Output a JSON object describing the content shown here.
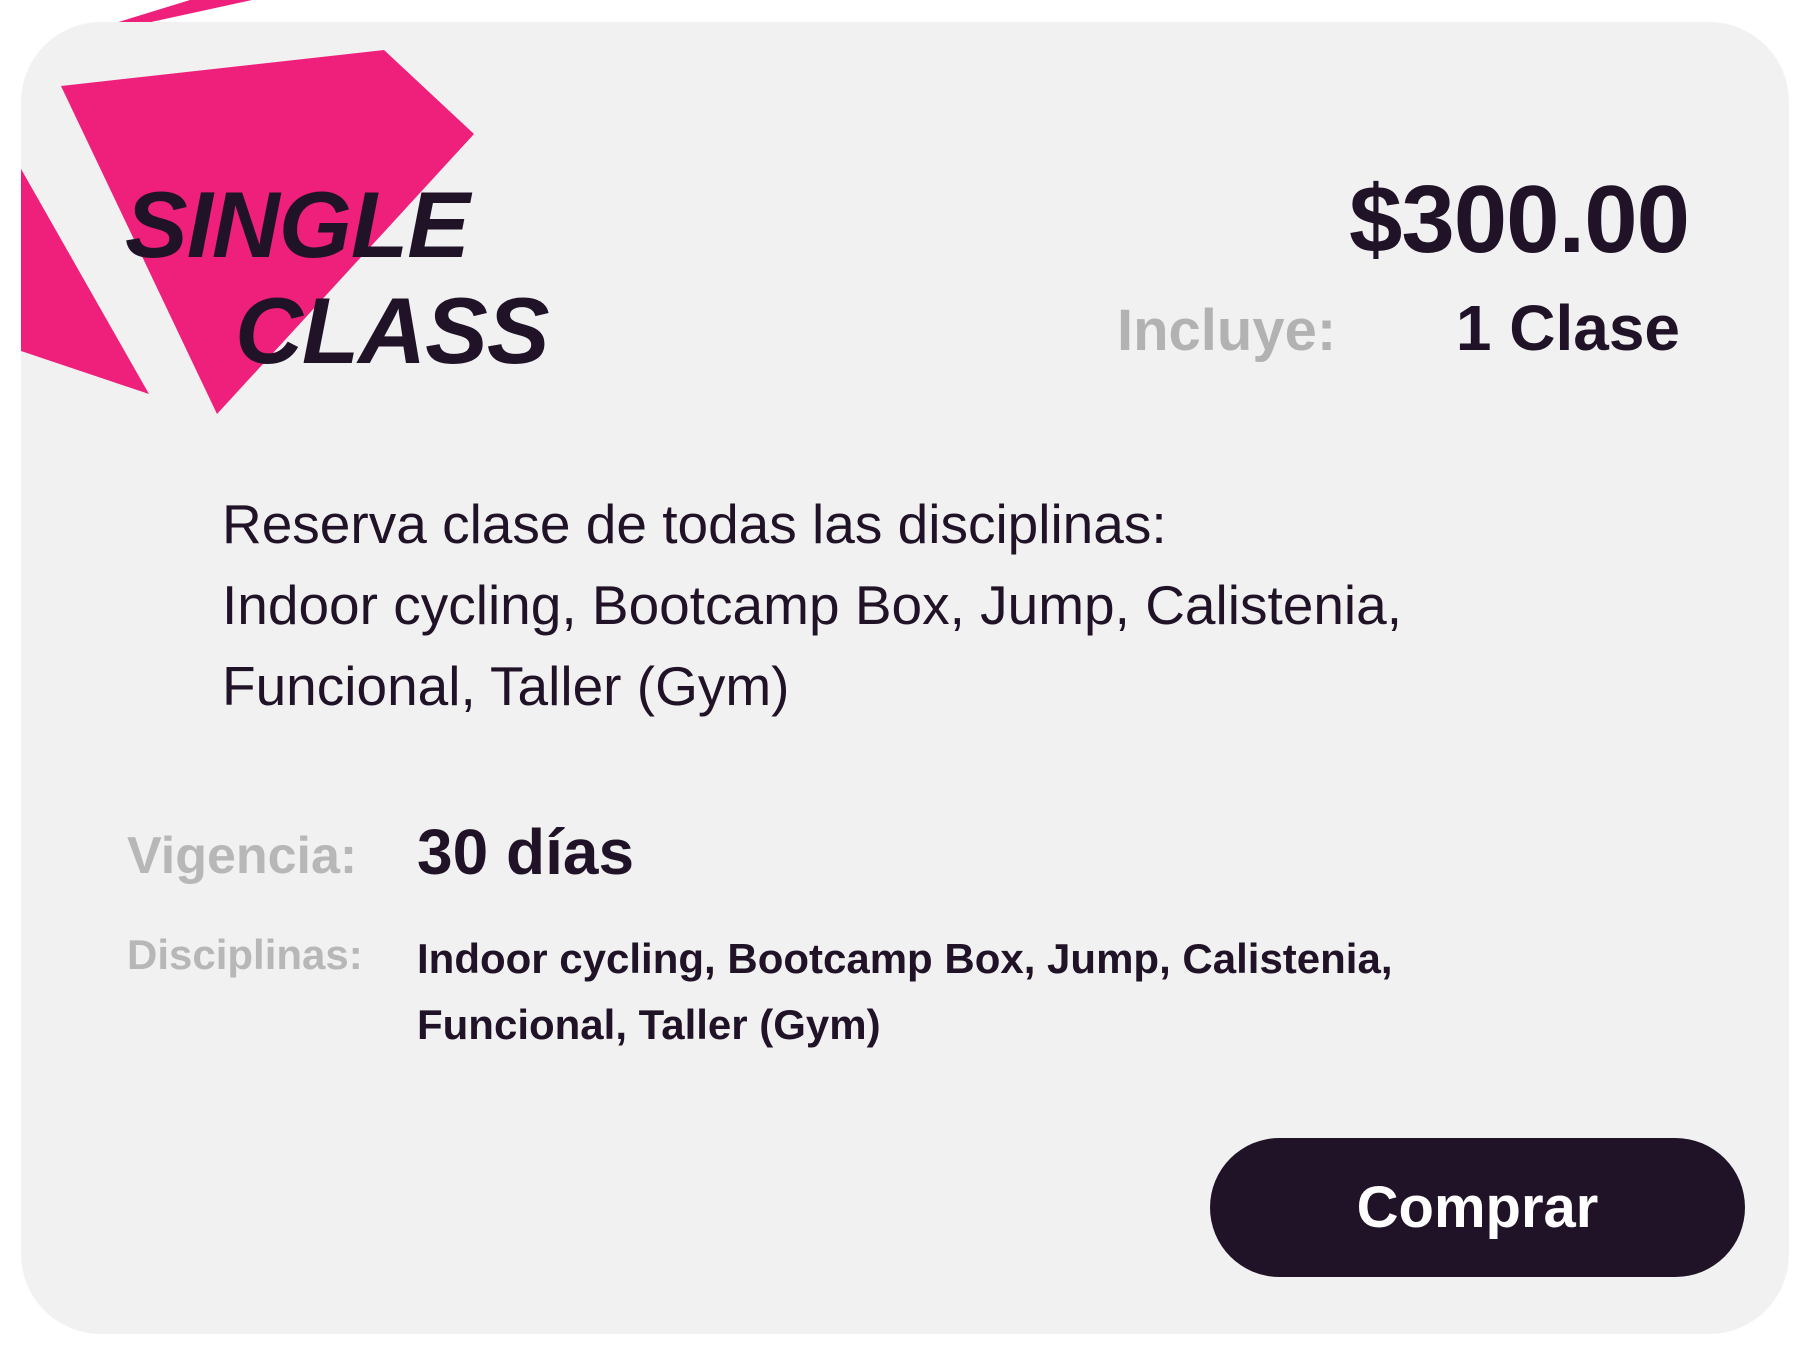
{
  "plan": {
    "title_line1": "SINGLE",
    "title_line2": "CLASS",
    "price": "$300.00",
    "includes_label": "Incluye:",
    "includes_value": "1 Clase"
  },
  "description": {
    "line1": "Reserva clase de todas las disciplinas:",
    "line2": "Indoor cycling, Bootcamp Box, Jump, Calistenia,",
    "line3": "Funcional, Taller (Gym)"
  },
  "details": {
    "validity_label": "Vigencia:",
    "validity_value": "30 días",
    "disciplines_label": "Disciplinas:",
    "disciplines_line1": "Indoor cycling, Bootcamp Box, Jump, Calistenia,",
    "disciplines_line2": "Funcional, Taller (Gym)"
  },
  "actions": {
    "buy_label": "Comprar"
  },
  "colors": {
    "accent": "#ef207b",
    "dark": "#211327",
    "muted": "#b2b2b2",
    "card_bg": "#f1f1f1"
  }
}
